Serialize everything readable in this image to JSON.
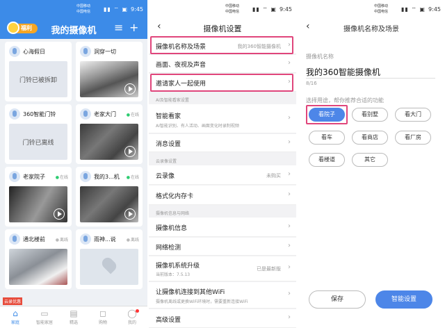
{
  "status_bar": {
    "carrier1": "中国移动",
    "carrier2": "中国电信",
    "icons": "▮▮ ⌔ ▣",
    "battery": "66",
    "time": "9:45"
  },
  "home": {
    "logo_text": "福利",
    "title": "我的摄像机",
    "menu_icon": "≡",
    "add_icon": "+",
    "cameras": [
      {
        "name": "心海假日",
        "status": "",
        "message": "门铃已被拆卸"
      },
      {
        "name": "洞穿一切",
        "status": "",
        "message": ""
      },
      {
        "name": "360智能门铃",
        "status": "",
        "message": "门铃已离线"
      },
      {
        "name": "老家大门",
        "status": "在线",
        "message": ""
      },
      {
        "name": "老家院子",
        "status": "在线",
        "message": ""
      },
      {
        "name": "我的3...机",
        "status": "在线",
        "message": ""
      },
      {
        "name": "通北楼前",
        "status": "离线",
        "message": ""
      },
      {
        "name": "雨神...说",
        "status": "离线",
        "message": ""
      }
    ],
    "banner_tag": "云录优惠",
    "tabs": [
      {
        "label": "家庭",
        "icon": "⌂"
      },
      {
        "label": "智能家居",
        "icon": "▭"
      },
      {
        "label": "精选",
        "icon": "▤"
      },
      {
        "label": "购物",
        "icon": "◻"
      },
      {
        "label": "我的",
        "icon": "◯"
      }
    ]
  },
  "settings": {
    "title": "摄像机设置",
    "rows": {
      "name_scene": {
        "label": "摄像机名称及场景",
        "value": "我的360智能摄像机"
      },
      "picture": {
        "label": "画面、夜视及声音"
      },
      "invite": {
        "label": "邀请家人一起使用"
      },
      "ai_section": "AI及智能看家设置",
      "smart_watch": {
        "label": "智能看家",
        "sub": "AI智能识别、有人活动、画面变化时录制视频"
      },
      "messages": {
        "label": "消息设置"
      },
      "cloud_section": "云录像设置",
      "cloud": {
        "label": "云录像",
        "value": "未购买"
      },
      "format": {
        "label": "格式化内存卡"
      },
      "info_section": "摄像机信息与网络",
      "info": {
        "label": "摄像机信息"
      },
      "network": {
        "label": "网络检测"
      },
      "upgrade": {
        "label": "摄像机系统升级",
        "sub": "当前版本：7.5.13",
        "value": "已是最新版"
      },
      "wifi": {
        "label": "让摄像机连接到其他WiFi",
        "sub": "摄像机离线或更换WiFi环境时，需要重新连接WiFi"
      },
      "advanced": {
        "label": "高级设置"
      }
    }
  },
  "name_scene": {
    "title": "摄像机名称及场景",
    "name_label": "摄像机名称",
    "name_value": "我的360智能摄像机",
    "count": "8/16",
    "purpose_label": "选择用途，帮你推荐合适的功能",
    "chips": [
      "看院子",
      "看别墅",
      "看大门",
      "看车",
      "看商店",
      "看厂房",
      "看楼道",
      "其它"
    ],
    "save_label": "保存",
    "smart_label": "智能设置"
  },
  "colors": {
    "accent": "#3c8be8",
    "highlight": "#e0457b",
    "chip_selected": "#4d86e8"
  }
}
